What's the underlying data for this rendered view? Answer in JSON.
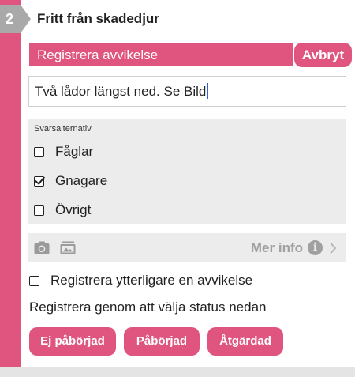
{
  "section": {
    "step_number": "2",
    "title": "Fritt från skadedjur"
  },
  "deviation": {
    "register_label": "Registrera avvikelse",
    "cancel_label": "Avbryt"
  },
  "comment": {
    "value": "Två lådor längst ned. Se Bild",
    "placeholder": ""
  },
  "answers": {
    "heading": "Svarsalternativ",
    "options": [
      {
        "label": "Fåglar",
        "checked": false
      },
      {
        "label": "Gnagare",
        "checked": true
      },
      {
        "label": "Övrigt",
        "checked": false
      }
    ]
  },
  "tools": {
    "camera_icon": "camera-icon",
    "gallery_icon": "image-gallery-icon",
    "more_info_label": "Mer info",
    "info_icon": "info-icon",
    "chevron_icon": "chevron-right-icon"
  },
  "extra": {
    "label": "Registrera ytterligare en avvikelse",
    "checked": false
  },
  "status": {
    "hint": "Registrera genom att välja status nedan",
    "buttons": [
      "Ej påbörjad",
      "Påbörjad",
      "Åtgärdad"
    ]
  },
  "colors": {
    "accent": "#e0557f",
    "badge": "#a9a9a9",
    "panel": "#ececec",
    "muted": "#a0a0a0"
  }
}
